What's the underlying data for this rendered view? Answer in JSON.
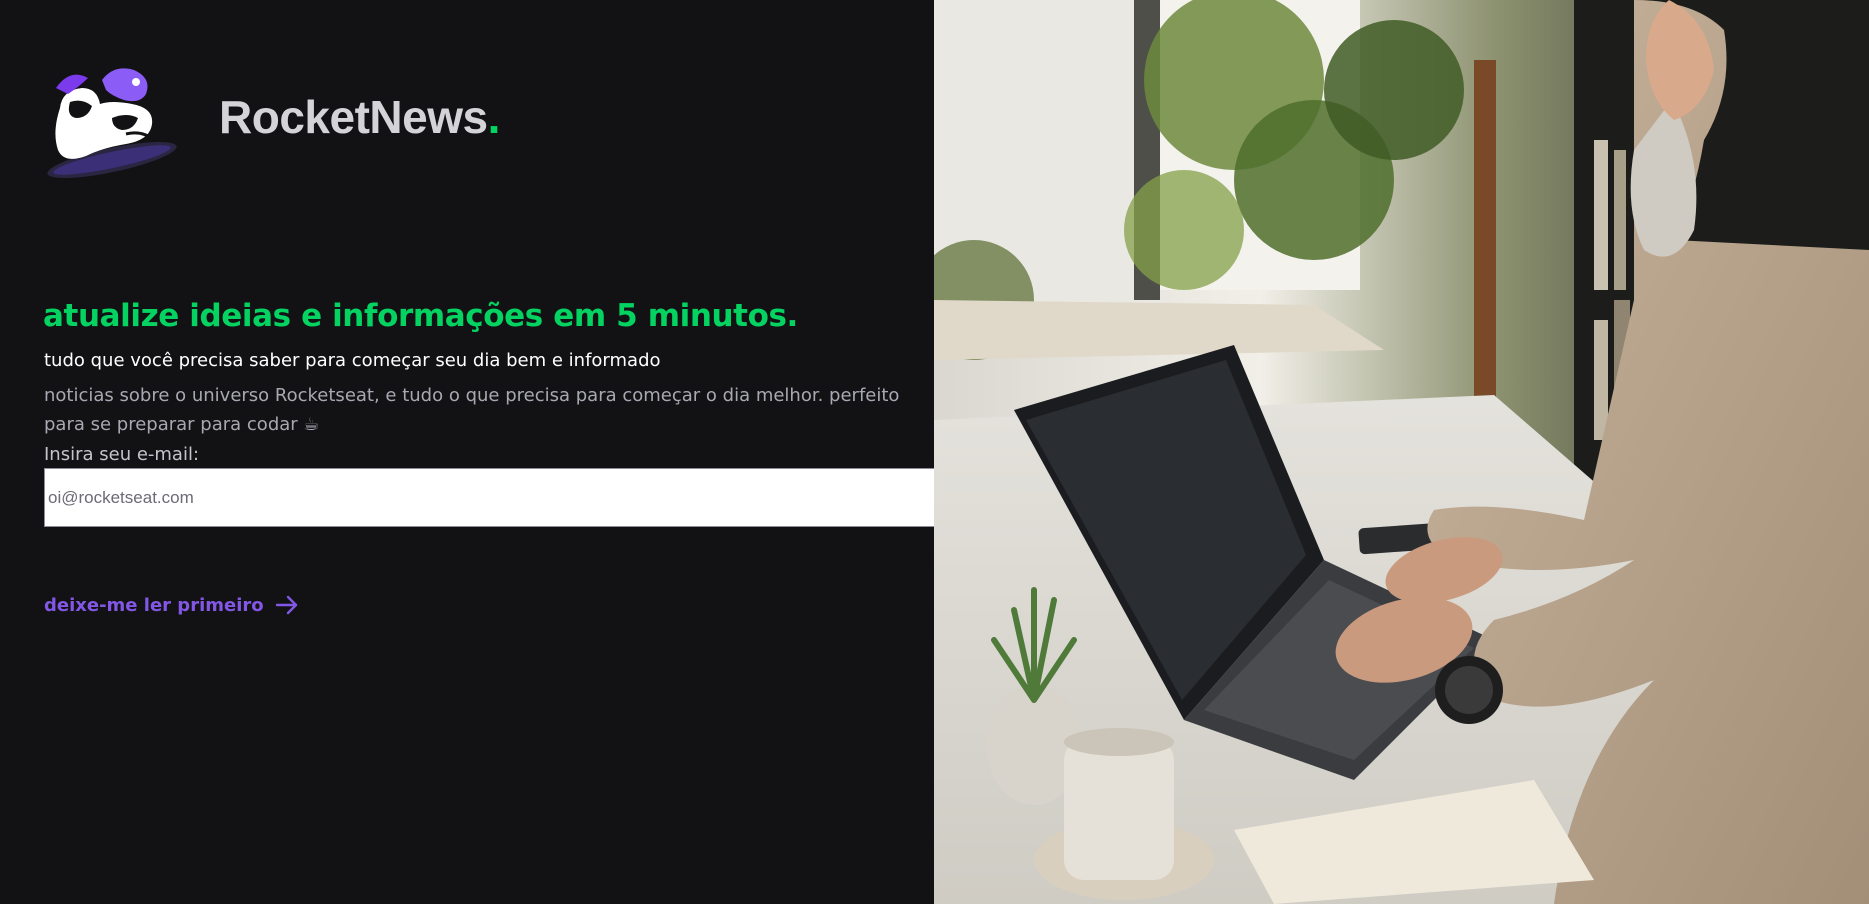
{
  "brand": {
    "name": "RocketNews",
    "dot": ".",
    "mascot_icon": "rocket-astronaut-mascot-icon"
  },
  "hero": {
    "headline": "atualize ideias e informações em 5 minutos.",
    "subtitle": "tudo que você precisa saber para começar seu dia bem e informado",
    "description": "noticias sobre o universo Rocketseat, e tudo o que precisa para começar o dia melhor. perfeito para se preparar para codar ☕"
  },
  "signup": {
    "label": "Insira seu e-mail:",
    "placeholder": "oi@rocketseat.com",
    "submit_icon": "paper-plane-send-icon"
  },
  "link": {
    "label": "deixe-me ler primeiro",
    "icon": "arrow-right-icon"
  },
  "photo": {
    "subject": "man typing on laptop at cafe table"
  },
  "colors": {
    "background": "#121214",
    "accent_green": "#04d361",
    "accent_purple": "#8257e5",
    "text_white": "#ffffff",
    "text_muted": "#a8a8b3"
  }
}
